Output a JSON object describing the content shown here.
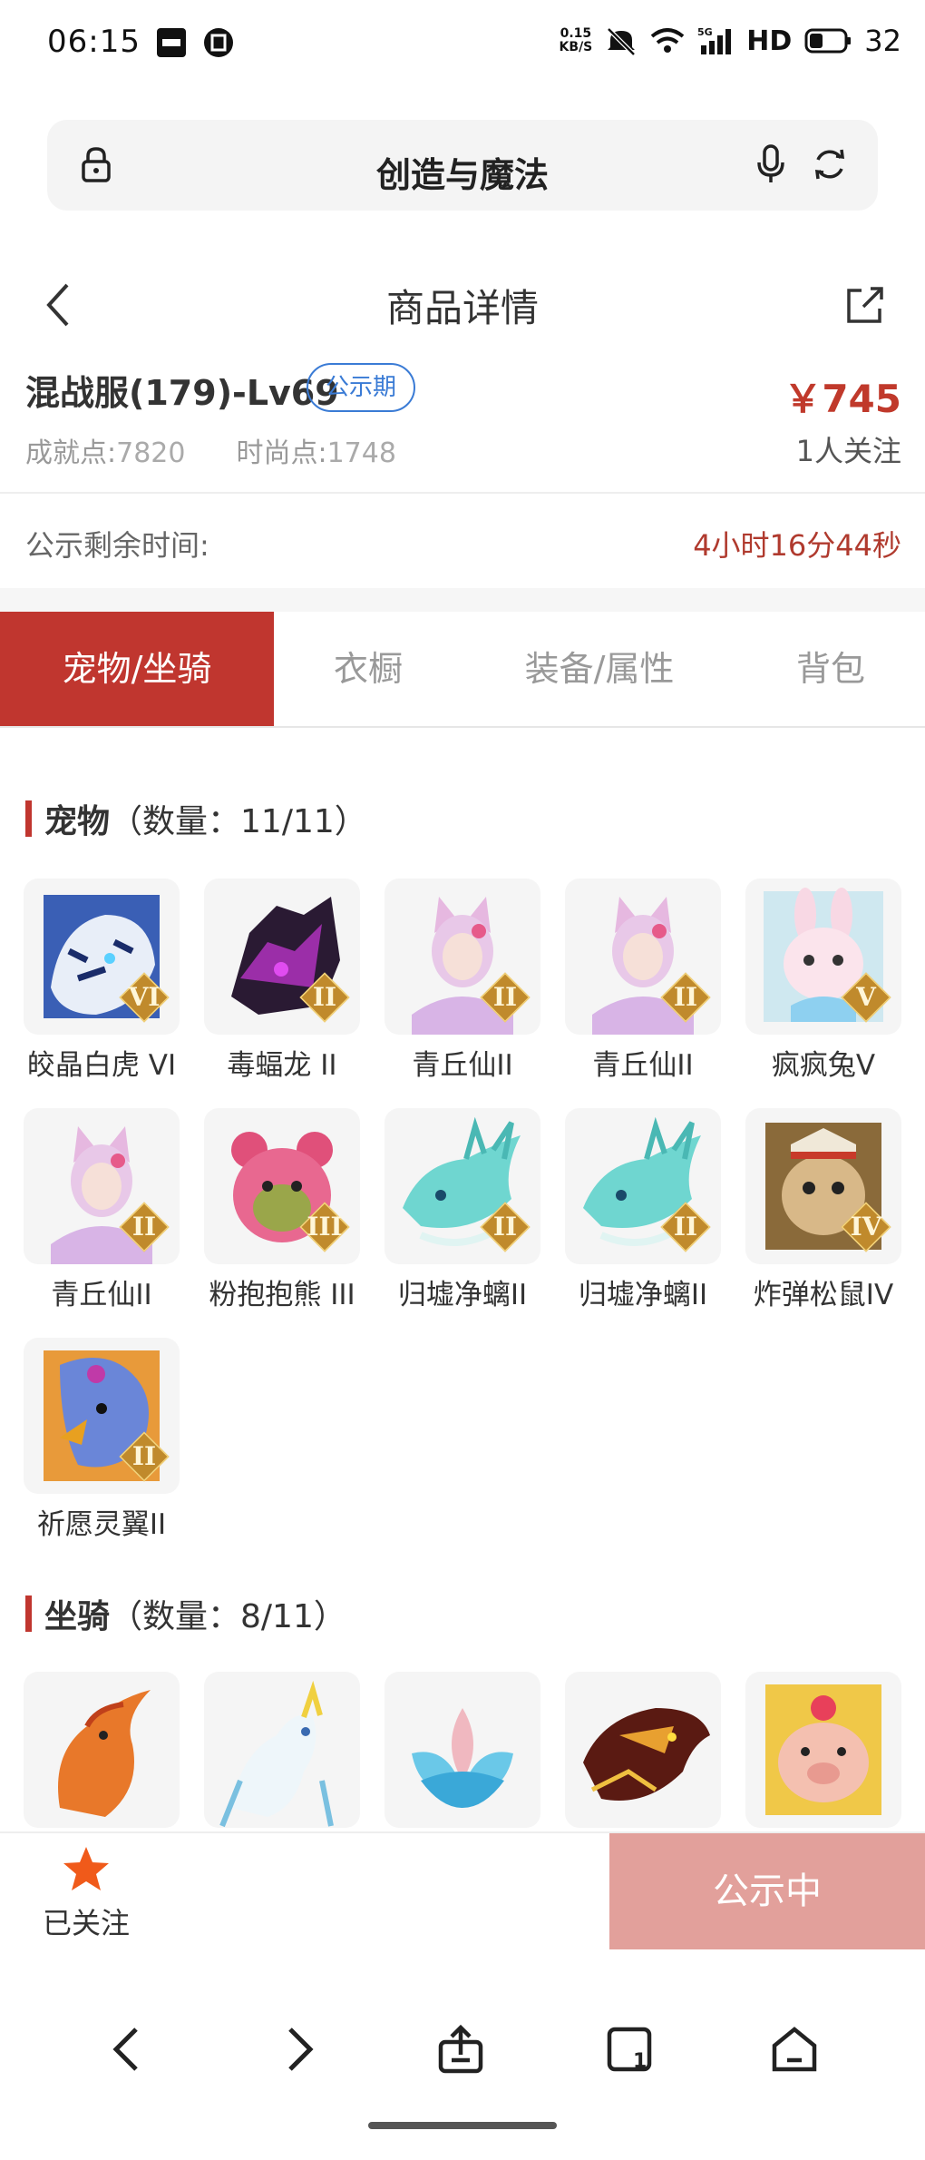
{
  "status_bar": {
    "time": "06:15",
    "net_speed_top": "0.15",
    "net_speed_bottom": "KB/S",
    "network": "5G",
    "hd": "HD",
    "battery": "32"
  },
  "url_bar": {
    "title": "创造与魔法"
  },
  "header": {
    "title": "商品详情"
  },
  "product": {
    "name": "混战服(179)-Lv69",
    "badge": "公示期",
    "price": "￥745",
    "achievement_label": "成就点:",
    "achievement_value": "7820",
    "fashion_label": "时尚点:",
    "fashion_value": "1748",
    "watchers": "1人关注",
    "remaining_label": "公示剩余时间:",
    "remaining_value": "4小时16分44秒"
  },
  "tabs": [
    {
      "label": "宠物/坐骑",
      "active": true
    },
    {
      "label": "衣橱",
      "active": false
    },
    {
      "label": "装备/属性",
      "active": false
    },
    {
      "label": "背包",
      "active": false
    }
  ],
  "pets": {
    "title": "宠物",
    "count": "（数量：11/11）",
    "items": [
      {
        "name": "皎晶白虎 VI",
        "rank": "VI",
        "icon": "white-tiger-icon"
      },
      {
        "name": "毒蝠龙 II",
        "rank": "II",
        "icon": "poison-bat-dragon-icon"
      },
      {
        "name": "青丘仙II",
        "rank": "II",
        "icon": "fox-fairy-icon"
      },
      {
        "name": "青丘仙II",
        "rank": "II",
        "icon": "fox-fairy-icon"
      },
      {
        "name": "疯疯兔V",
        "rank": "V",
        "icon": "crazy-rabbit-icon"
      },
      {
        "name": "青丘仙II",
        "rank": "II",
        "icon": "fox-fairy-icon"
      },
      {
        "name": "粉抱抱熊 III",
        "rank": "III",
        "icon": "pink-bear-icon"
      },
      {
        "name": "归墟净螭II",
        "rank": "II",
        "icon": "cyan-dragon-icon"
      },
      {
        "name": "归墟净螭II",
        "rank": "II",
        "icon": "cyan-dragon-icon"
      },
      {
        "name": "炸弹松鼠IV",
        "rank": "IV",
        "icon": "bomb-squirrel-icon"
      },
      {
        "name": "祈愿灵翼II",
        "rank": "II",
        "icon": "wish-eagle-icon"
      }
    ]
  },
  "mounts": {
    "title": "坐骑",
    "count": "（数量：8/11）",
    "items": [
      {
        "icon": "phoenix-icon"
      },
      {
        "icon": "white-dragon-icon"
      },
      {
        "icon": "lotus-icon"
      },
      {
        "icon": "lava-dragon-icon"
      },
      {
        "icon": "pig-icon"
      }
    ]
  },
  "bottom": {
    "follow_label": "已关注",
    "status_button": "公示中"
  },
  "colors": {
    "accent": "#c0362f",
    "price": "#c0392b",
    "badge": "#3a7bd5",
    "status_button": "#e2a09b",
    "star": "#f05a1a"
  }
}
